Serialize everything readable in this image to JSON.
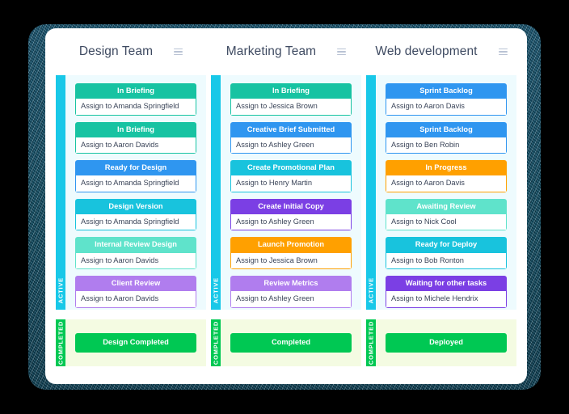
{
  "palette": {
    "teal": "#17c3a2",
    "blue": "#2f96f0",
    "cyan": "#18c3dd",
    "mint": "#5fe3cb",
    "light_purple": "#b07dee",
    "dark_purple": "#7b3fe4",
    "orange": "#ffa000",
    "green": "#00c853",
    "lane_bar": "#18c8e8",
    "lane_bg": "#eefbfe",
    "done_bg": "#f4fbe2",
    "frame": "#12566f",
    "title_text": "#3e4a61"
  },
  "menu_icon": "hamburger-icon",
  "columns": [
    {
      "title": "Design Team",
      "active_label": "ACTIVE",
      "completed_label": "COMPLETED",
      "completed_card": "Design Completed",
      "cards": [
        {
          "title": "In Briefing",
          "assignee": "Assign to Amanda Springfield",
          "color": "teal"
        },
        {
          "title": "In Briefing",
          "assignee": "Assign to Aaron Davids",
          "color": "teal"
        },
        {
          "title": "Ready for Design",
          "assignee": "Assign to Amanda Springfield",
          "color": "blue"
        },
        {
          "title": "Design Version",
          "assignee": "Assign to Amanda Springfield",
          "color": "cyan"
        },
        {
          "title": "Internal Review Design",
          "assignee": "Assign to Aaron Davids",
          "color": "mint"
        },
        {
          "title": "Client Review",
          "assignee": "Assign to Aaron Davids",
          "color": "light_purple"
        }
      ]
    },
    {
      "title": "Marketing Team",
      "active_label": "ACTIVE",
      "completed_label": "COMPLETED",
      "completed_card": "Completed",
      "cards": [
        {
          "title": "In Briefing",
          "assignee": "Assign to Jessica Brown",
          "color": "teal"
        },
        {
          "title": "Creative Brief Submitted",
          "assignee": "Assign to Ashley Green",
          "color": "blue"
        },
        {
          "title": "Create Promotional Plan",
          "assignee": "Assign to Henry Martin",
          "color": "cyan"
        },
        {
          "title": "Create Initial Copy",
          "assignee": "Assign to Ashley Green",
          "color": "dark_purple"
        },
        {
          "title": "Launch Promotion",
          "assignee": "Assign to Jessica Brown",
          "color": "orange"
        },
        {
          "title": "Review Metrics",
          "assignee": "Assign to Ashley Green",
          "color": "light_purple"
        }
      ]
    },
    {
      "title": "Web development",
      "active_label": "ACTIVE",
      "completed_label": "COMPLETED",
      "completed_card": "Deployed",
      "cards": [
        {
          "title": "Sprint Backlog",
          "assignee": "Assign to Aaron Davis",
          "color": "blue"
        },
        {
          "title": "Sprint Backlog",
          "assignee": "Assign to Ben Robin",
          "color": "blue"
        },
        {
          "title": "In Progress",
          "assignee": "Assign to Aaron Davis",
          "color": "orange"
        },
        {
          "title": "Awaiting Review",
          "assignee": "Assign to Nick Cool",
          "color": "mint"
        },
        {
          "title": "Ready for Deploy",
          "assignee": "Assign to Bob Ronton",
          "color": "cyan"
        },
        {
          "title": "Waiting for other tasks",
          "assignee": "Assign to Michele Hendrix",
          "color": "dark_purple"
        }
      ]
    }
  ]
}
